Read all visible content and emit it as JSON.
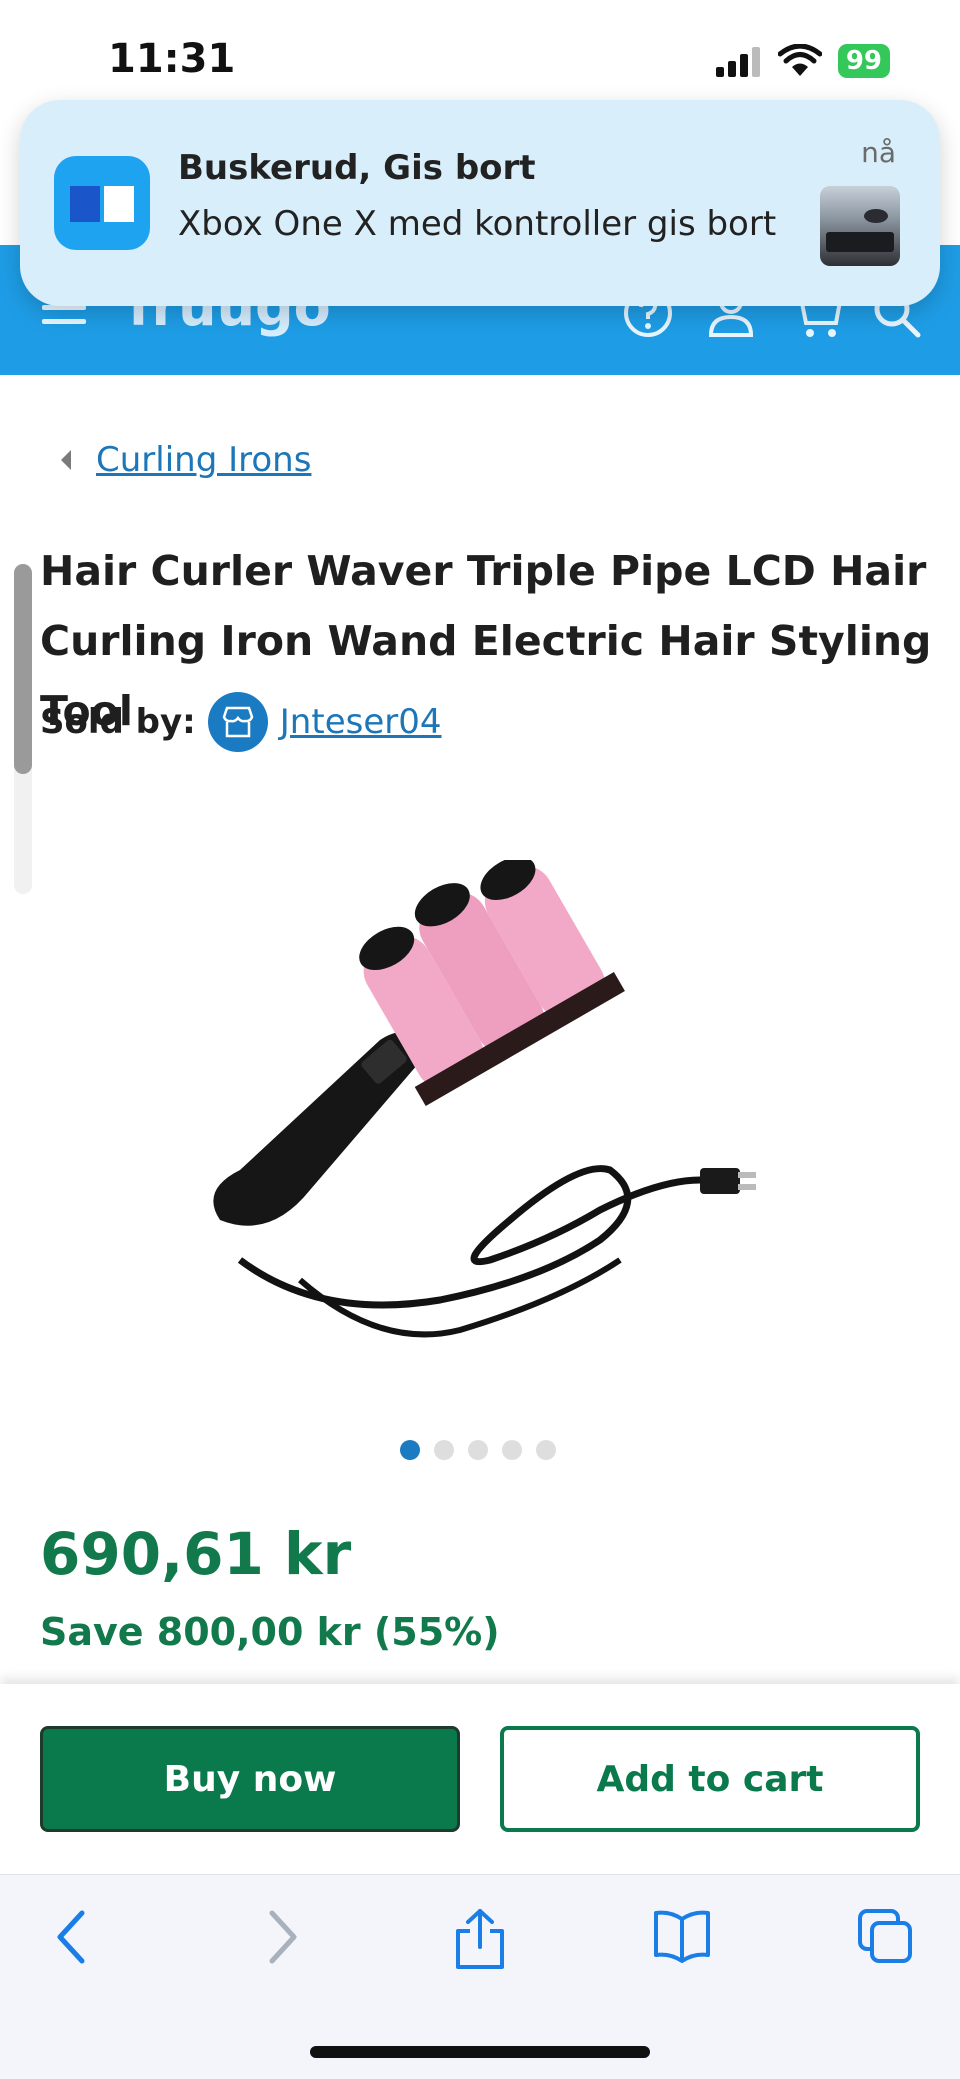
{
  "status_bar": {
    "time": "11:31",
    "battery": "99"
  },
  "notification": {
    "title": "Buskerud, Gis bort",
    "body": "Xbox One X med kontroller gis bort",
    "time": "nå"
  },
  "header": {
    "logo": "fruugo",
    "icons": [
      "menu-icon",
      "help-icon",
      "account-icon",
      "cart-icon",
      "search-icon"
    ],
    "color": "#1e9de6"
  },
  "breadcrumb": {
    "label": "Curling Irons"
  },
  "product": {
    "title": "Hair Curler Waver Triple Pipe LCD Hair Curling Iron Wand Electric Hair Styling Tool",
    "sold_by_label": "Sold by:",
    "seller": "Jnteser04",
    "price": "690,61 kr",
    "savings": "Save 800,00 kr (55%)",
    "image_dots": {
      "count": 5,
      "active": 1
    }
  },
  "actions": {
    "buy_now": "Buy now",
    "add_to_cart": "Add to cart"
  },
  "browser_toolbar": {
    "icons": [
      "back-icon",
      "forward-icon",
      "share-icon",
      "bookmarks-icon",
      "tabs-icon"
    ]
  },
  "colors": {
    "price_green": "#11794b",
    "link_blue": "#1c76b8",
    "button_green": "#0a7a4d"
  }
}
